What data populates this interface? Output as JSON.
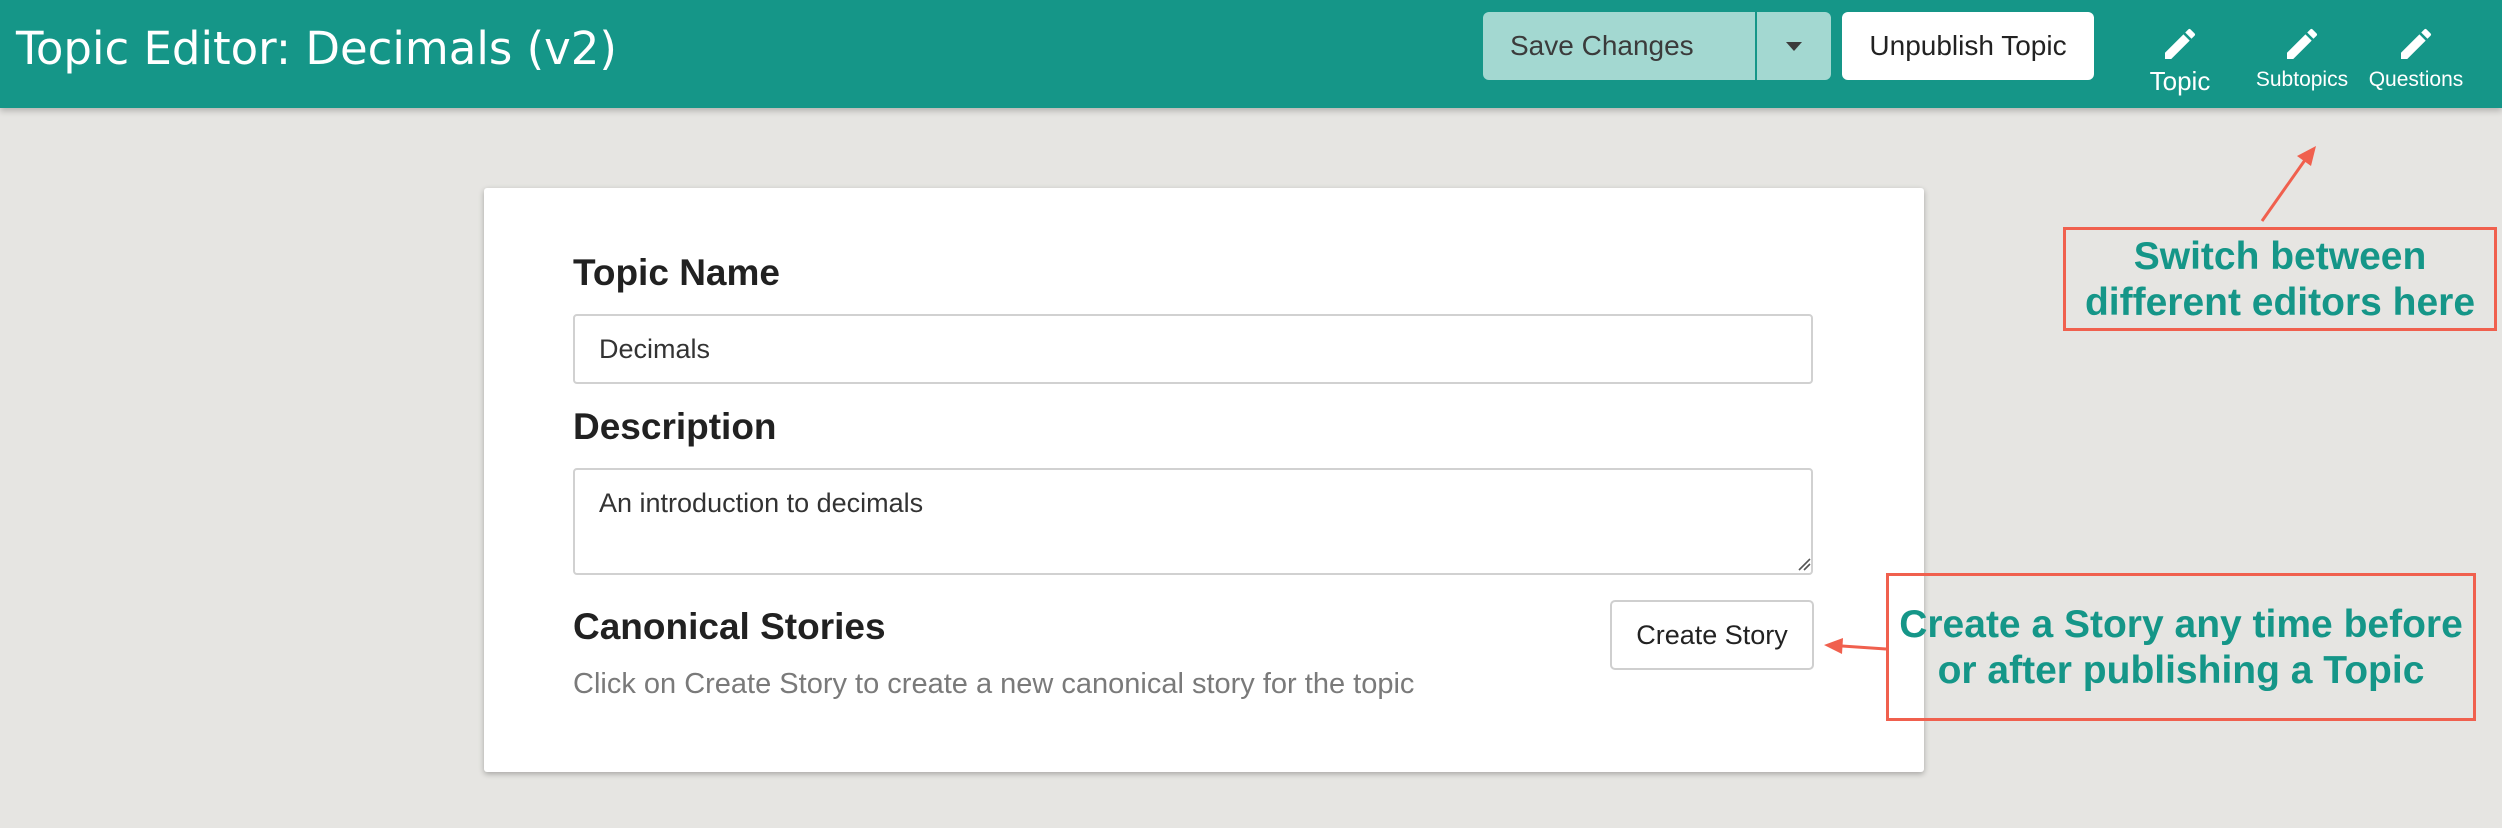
{
  "header": {
    "title": "Topic Editor: Decimals (v2)",
    "save_label": "Save Changes",
    "unpublish_label": "Unpublish Topic",
    "nav": [
      {
        "label": "Topic",
        "icon": "pencil-icon"
      },
      {
        "label": "Subtopics",
        "icon": "pencil-icon"
      },
      {
        "label": "Questions",
        "icon": "pencil-icon"
      }
    ],
    "colors": {
      "bar": "#159688",
      "save_button": "#a3d8d1"
    }
  },
  "form": {
    "topic_name_label": "Topic Name",
    "topic_name_value": "Decimals",
    "description_label": "Description",
    "description_value": "An introduction to decimals",
    "stories_label": "Canonical Stories",
    "stories_hint": "Click on Create Story to create a new canonical story for the topic",
    "create_story_label": "Create Story"
  },
  "annotations": {
    "editors_note_line1": "Switch between",
    "editors_note_line2": "different editors here",
    "story_note_line1": "Create a Story any time before",
    "story_note_line2": "or after publishing a Topic",
    "colors": {
      "border": "#f0604e",
      "text": "#159688"
    }
  }
}
